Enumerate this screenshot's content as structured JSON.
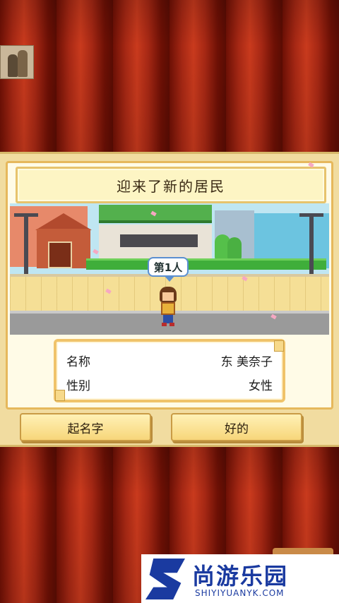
{
  "banner": {
    "title": "迎来了新的居民"
  },
  "scene": {
    "bubble_label": "第1人"
  },
  "info": {
    "name_label": "名称",
    "name_value": "东 美奈子",
    "gender_label": "性别",
    "gender_value": "女性"
  },
  "buttons": {
    "rename_label": "起名字",
    "ok_label": "好的"
  },
  "watermark": {
    "brand_cn": "尚游乐园",
    "brand_en": "SHIYIYUANYK.COM"
  },
  "colors": {
    "curtain": "#a72814",
    "frame": "#f1dca0",
    "button": "#f7d67a",
    "brand": "#1a3aa0"
  }
}
